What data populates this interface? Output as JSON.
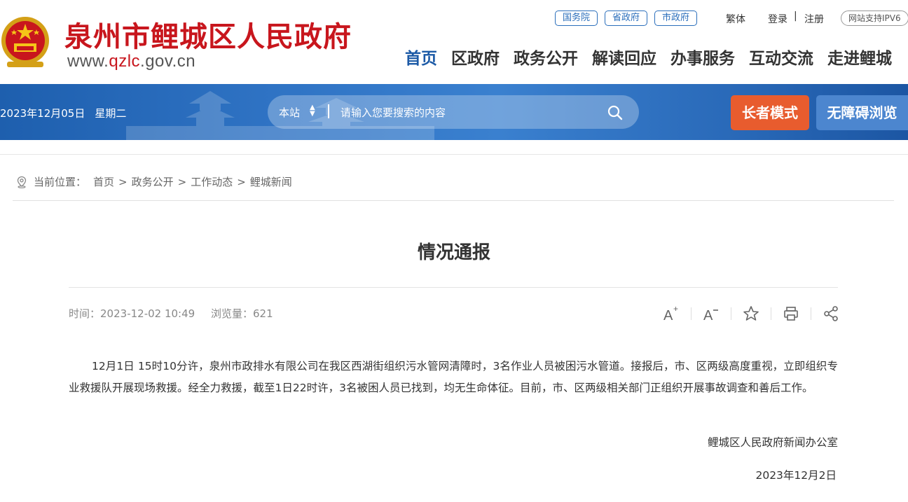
{
  "header": {
    "site_title": "泉州市鲤城区人民政府",
    "site_url_prefix": "www.",
    "site_url_highlight": "qzlc",
    "site_url_suffix": ".gov.cn",
    "top_links": [
      "国务院",
      "省政府",
      "市政府"
    ],
    "traditional": "繁体",
    "login": "登录",
    "separator": "|",
    "register": "注册",
    "ipv6": "网站支持IPV6",
    "nav": [
      "首页",
      "区政府",
      "政务公开",
      "解读回应",
      "办事服务",
      "互动交流",
      "走进鲤城"
    ],
    "active_nav_color": "#1c5aa6",
    "title_color": "#c8161d"
  },
  "banner": {
    "date": "2023年12月05日",
    "weekday": "星期二",
    "search_scope": "本站",
    "search_placeholder": "请输入您要搜索的内容",
    "elder_mode": "长者模式",
    "accessible_browse": "无障碍浏览",
    "elder_color": "#e85c2e",
    "access_color": "#4c86cf"
  },
  "breadcrumb": {
    "label": "当前位置：",
    "items": [
      "首页",
      "政务公开",
      "工作动态",
      "鲤城新闻"
    ],
    "sep": ">"
  },
  "article": {
    "title": "情况通报",
    "time_label": "时间：",
    "time": "2023-12-02 10:49",
    "views_label": "浏览量：",
    "views": "621",
    "body": "12月1日 15时10分许，泉州市政排水有限公司在我区西湖街组织污水管网清障时，3名作业人员被困污水管道。接报后，市、区两级高度重视，立即组织专业救援队开展现场救援。经全力救援，截至1日22时许，3名被困人员已找到，均无生命体征。目前，市、区两级相关部门正组织开展事故调查和善后工作。",
    "signature": "鲤城区人民政府新闻办公室",
    "sign_date": "2023年12月2日",
    "tools": [
      "font-increase-icon",
      "font-decrease-icon",
      "favorite-icon",
      "print-icon",
      "share-icon"
    ]
  }
}
